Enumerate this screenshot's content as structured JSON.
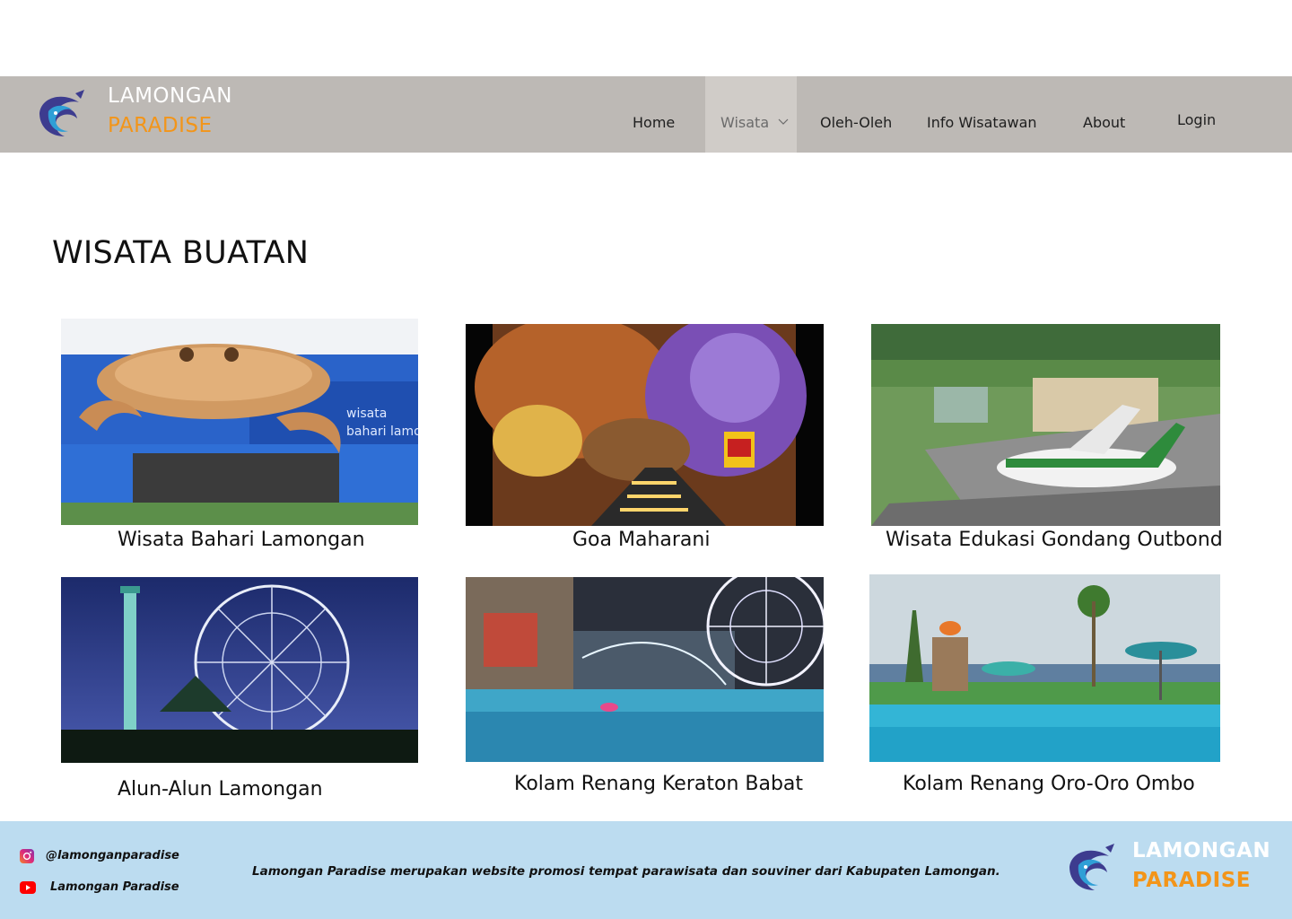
{
  "brand": {
    "line1": "LAMONGAN",
    "line2": "PARADISE"
  },
  "nav": {
    "items": [
      {
        "label": "Home"
      },
      {
        "label": "Wisata"
      },
      {
        "label": "Oleh-Oleh"
      },
      {
        "label": "Info Wisatawan"
      },
      {
        "label": "About"
      }
    ],
    "login": "Login",
    "active": "Wisata"
  },
  "page": {
    "title": "WISATA BUATAN"
  },
  "cards": [
    {
      "caption": "Wisata Bahari Lamongan"
    },
    {
      "caption": "Goa Maharani"
    },
    {
      "caption": "Wisata Edukasi Gondang Outbond"
    },
    {
      "caption": "Alun-Alun Lamongan"
    },
    {
      "caption": "Kolam Renang Keraton Babat"
    },
    {
      "caption": "Kolam Renang Oro-Oro Ombo"
    }
  ],
  "footer": {
    "instagram": "@lamonganparadise",
    "youtube": "Lamongan Paradise",
    "description": "Lamongan Paradise merupakan website promosi tempat parawisata dan souviner dari Kabupaten Lamongan.",
    "brand_line1": "LAMONGAN",
    "brand_line2": "PARADISE"
  },
  "colors": {
    "navbar": "#bdb9b5",
    "brand_orange": "#f39519",
    "footer_bg": "#bcdcf0"
  }
}
